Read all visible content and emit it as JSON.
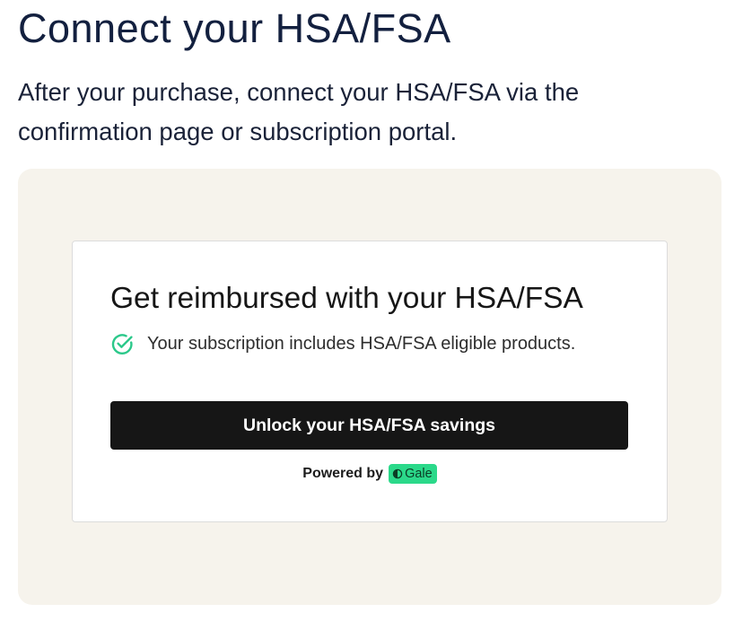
{
  "header": {
    "title": "Connect your HSA/FSA",
    "intro": "After your purchase, connect your HSA/FSA via the confirmation page or subscription portal."
  },
  "card": {
    "title": "Get reimbursed with your HSA/FSA",
    "eligibility_text": "Your subscription includes HSA/FSA eligible products.",
    "check_icon": "check-circle-icon",
    "button_label": "Unlock your HSA/FSA savings",
    "powered_by_label": "Powered by",
    "brand_name": "Gale",
    "brand_icon": "gale-logo-icon"
  },
  "colors": {
    "title_text": "#13203f",
    "panel_background": "#f6f3ec",
    "button_background": "#161616",
    "check_green": "#2bc88a",
    "badge_green": "#2bd98a"
  }
}
